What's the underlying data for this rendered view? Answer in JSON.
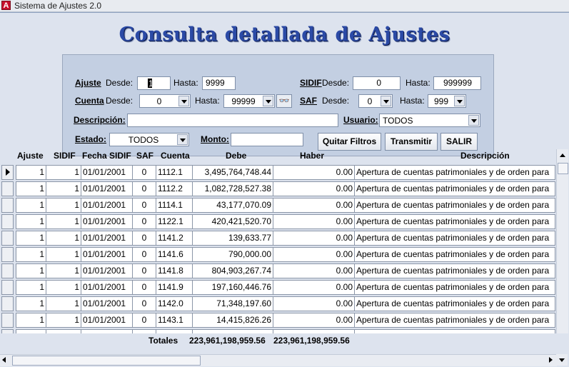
{
  "window": {
    "app_icon_letter": "A",
    "title": "Sistema de Ajustes 2.0"
  },
  "heading": "Consulta detallada de Ajustes",
  "filters": {
    "ajuste": {
      "label": "Ajuste",
      "desde_label": "Desde:",
      "desde": "1",
      "hasta_label": "Hasta:",
      "hasta": "9999"
    },
    "sidif": {
      "label": "SIDIF",
      "desde_label": "Desde:",
      "desde": "0",
      "hasta_label": "Hasta:",
      "hasta": "999999"
    },
    "cuenta": {
      "label": "Cuenta",
      "desde_label": "Desde:",
      "desde": "0",
      "hasta_label": "Hasta:",
      "hasta": "99999"
    },
    "saf": {
      "label": "SAF",
      "desde_label": "Desde:",
      "desde": "0",
      "hasta_label": "Hasta:",
      "hasta": "999"
    },
    "descripcion": {
      "label": "Descripción:",
      "value": ""
    },
    "usuario": {
      "label": "Usuario:",
      "value": "TODOS"
    },
    "estado": {
      "label": "Estado:",
      "value": "TODOS"
    },
    "monto": {
      "label": "Monto:",
      "value": ""
    }
  },
  "buttons": {
    "quitar": "Quitar Filtros",
    "transmitir": "Transmitir",
    "salir": "SALIR"
  },
  "grid": {
    "headers": {
      "ajuste": "Ajuste",
      "sidif": "SIDIF",
      "fecha": "Fecha SIDIF",
      "saf": "SAF",
      "cuenta": "Cuenta",
      "debe": "Debe",
      "haber": "Haber",
      "descripcion": "Descripción"
    },
    "rows": [
      {
        "ajuste": "1",
        "sidif": "1",
        "fecha": "01/01/2001",
        "saf": "0",
        "cuenta": "1112.1",
        "debe": "3,495,764,748.44",
        "haber": "0.00",
        "descripcion": "Apertura de cuentas patrimoniales y de orden para"
      },
      {
        "ajuste": "1",
        "sidif": "1",
        "fecha": "01/01/2001",
        "saf": "0",
        "cuenta": "1112.2",
        "debe": "1,082,728,527.38",
        "haber": "0.00",
        "descripcion": "Apertura de cuentas patrimoniales y de orden para"
      },
      {
        "ajuste": "1",
        "sidif": "1",
        "fecha": "01/01/2001",
        "saf": "0",
        "cuenta": "1114.1",
        "debe": "43,177,070.09",
        "haber": "0.00",
        "descripcion": "Apertura de cuentas patrimoniales y de orden para"
      },
      {
        "ajuste": "1",
        "sidif": "1",
        "fecha": "01/01/2001",
        "saf": "0",
        "cuenta": "1122.1",
        "debe": "420,421,520.70",
        "haber": "0.00",
        "descripcion": "Apertura de cuentas patrimoniales y de orden para"
      },
      {
        "ajuste": "1",
        "sidif": "1",
        "fecha": "01/01/2001",
        "saf": "0",
        "cuenta": "1141.2",
        "debe": "139,633.77",
        "haber": "0.00",
        "descripcion": "Apertura de cuentas patrimoniales y de orden para"
      },
      {
        "ajuste": "1",
        "sidif": "1",
        "fecha": "01/01/2001",
        "saf": "0",
        "cuenta": "1141.6",
        "debe": "790,000.00",
        "haber": "0.00",
        "descripcion": "Apertura de cuentas patrimoniales y de orden para"
      },
      {
        "ajuste": "1",
        "sidif": "1",
        "fecha": "01/01/2001",
        "saf": "0",
        "cuenta": "1141.8",
        "debe": "804,903,267.74",
        "haber": "0.00",
        "descripcion": "Apertura de cuentas patrimoniales y de orden para"
      },
      {
        "ajuste": "1",
        "sidif": "1",
        "fecha": "01/01/2001",
        "saf": "0",
        "cuenta": "1141.9",
        "debe": "197,160,446.76",
        "haber": "0.00",
        "descripcion": "Apertura de cuentas patrimoniales y de orden para"
      },
      {
        "ajuste": "1",
        "sidif": "1",
        "fecha": "01/01/2001",
        "saf": "0",
        "cuenta": "1142.0",
        "debe": "71,348,197.60",
        "haber": "0.00",
        "descripcion": "Apertura de cuentas patrimoniales y de orden para"
      },
      {
        "ajuste": "1",
        "sidif": "1",
        "fecha": "01/01/2001",
        "saf": "0",
        "cuenta": "1143.1",
        "debe": "14,415,826.26",
        "haber": "0.00",
        "descripcion": "Apertura de cuentas patrimoniales y de orden para"
      }
    ]
  },
  "totals": {
    "label": "Totales",
    "debe": "223,961,198,959.56",
    "haber": "223,961,198,959.56"
  },
  "icons": {
    "glasses": "glasses-icon"
  }
}
